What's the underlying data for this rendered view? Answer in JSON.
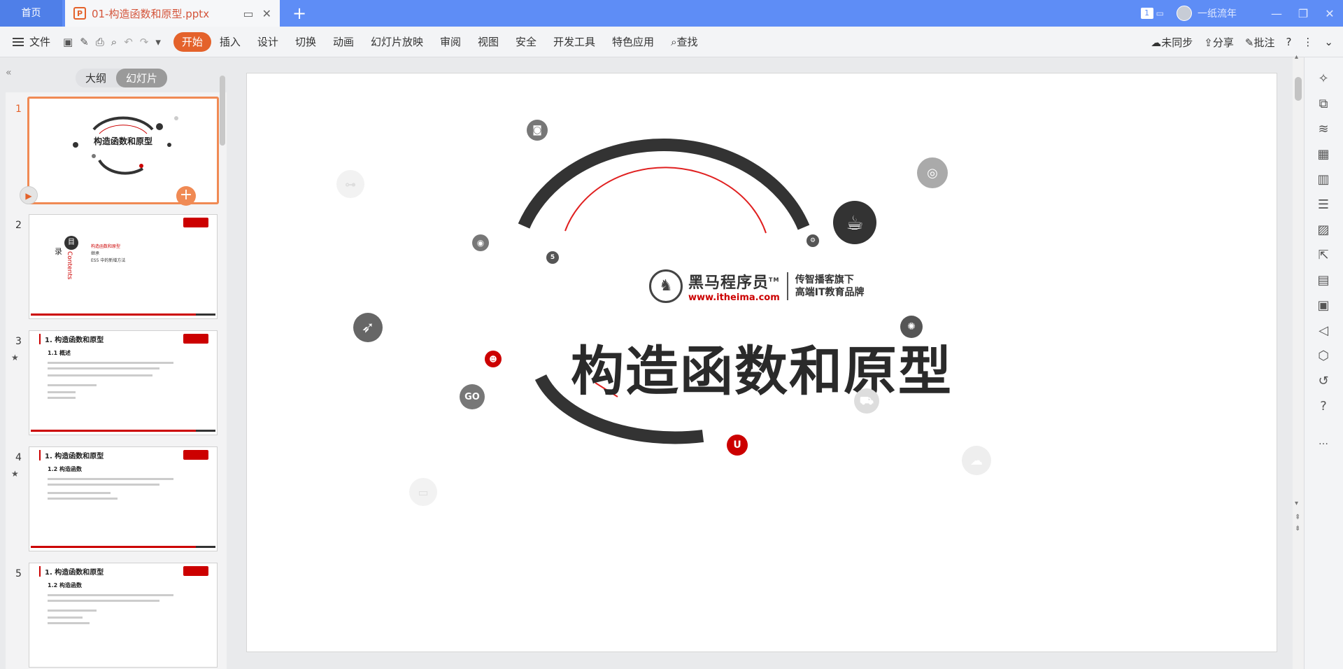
{
  "tabs": {
    "home": "首页",
    "doc_title": "01-构造函数和原型.pptx",
    "add_label": "+"
  },
  "titlebar": {
    "badge": "1",
    "user": "一纸流年",
    "min": "—",
    "restore": "❐",
    "close": "✕"
  },
  "menu": {
    "file": "文件"
  },
  "ribbon_tabs": [
    "开始",
    "插入",
    "设计",
    "切换",
    "动画",
    "幻灯片放映",
    "审阅",
    "视图",
    "安全",
    "开发工具",
    "特色应用",
    "查找"
  ],
  "ribbon_active": "开始",
  "ribbon_right": {
    "sync": "未同步",
    "share": "分享",
    "comment": "批注",
    "help": "?"
  },
  "panel": {
    "outline": "大纲",
    "slides": "幻灯片"
  },
  "thumbnails": [
    {
      "num": "1",
      "title": "构造函数和原型"
    },
    {
      "num": "2",
      "toc_head": "目",
      "toc_lu": "录",
      "toc_en": "Contents",
      "items": [
        "构造函数和原型",
        "继承",
        "ES5 中的新增方法"
      ]
    },
    {
      "num": "3",
      "heading": "1. 构造函数和原型",
      "sub": "1.1 概述"
    },
    {
      "num": "4",
      "heading": "1. 构造函数和原型",
      "sub": "1.2 构造函数"
    },
    {
      "num": "5",
      "heading": "1. 构造函数和原型",
      "sub": "1.2 构造函数"
    }
  ],
  "slide": {
    "title": "构造函数和原型",
    "logo_name": "黑马程序员",
    "logo_tm": "TM",
    "logo_url": "www.itheima.com",
    "slogan1": "传智播客旗下",
    "slogan2": "高端IT教育品牌",
    "go_label": "GO"
  },
  "colors": {
    "accent": "#e4622b",
    "tabbar": "#5e8df6",
    "brand_red": "#c00000",
    "dark": "#333333"
  },
  "icons": {
    "ppt": "ppt-file-icon",
    "play": "play-icon",
    "add": "add-slide-icon"
  }
}
